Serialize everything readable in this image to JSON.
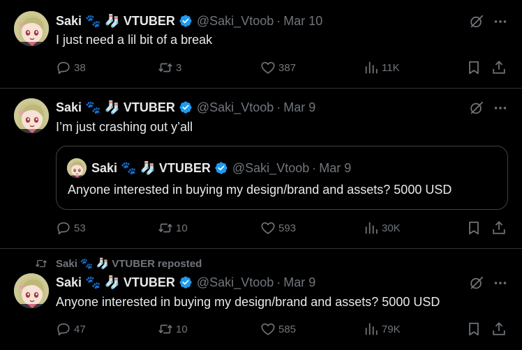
{
  "user": {
    "name": "Saki",
    "emoji1": "🐾",
    "emoji2": "🧦",
    "tag": "VTUBER",
    "handle": "@Saki_Vtoob",
    "separator": "·"
  },
  "tweets": [
    {
      "date": "Mar 10",
      "text": "I just need a lil bit of a break",
      "replies": "38",
      "reposts": "3",
      "likes": "387",
      "views": "11K"
    },
    {
      "date": "Mar 9",
      "text": "I’m just crashing out y’all",
      "quote": {
        "date": "Mar 9",
        "text": "Anyone interested in buying my design/brand and assets? 5000 USD"
      },
      "replies": "53",
      "reposts": "10",
      "likes": "593",
      "views": "30K"
    },
    {
      "repost_label": "reposted",
      "date": "Mar 9",
      "text": "Anyone interested in buying my design/brand and assets? 5000 USD",
      "replies": "47",
      "reposts": "10",
      "likes": "585",
      "views": "79K"
    }
  ],
  "icons": {
    "verified": "verified-badge-icon",
    "grok": "grok-icon",
    "more": "more-icon",
    "reply": "reply-icon",
    "repost": "repost-icon",
    "like": "heart-icon",
    "views": "views-icon",
    "bookmark": "bookmark-icon",
    "share": "share-icon"
  },
  "colors": {
    "background": "#000000",
    "text": "#e7e9ea",
    "muted": "#71767b",
    "verified": "#1d9bf0",
    "border": "#2f3336"
  }
}
